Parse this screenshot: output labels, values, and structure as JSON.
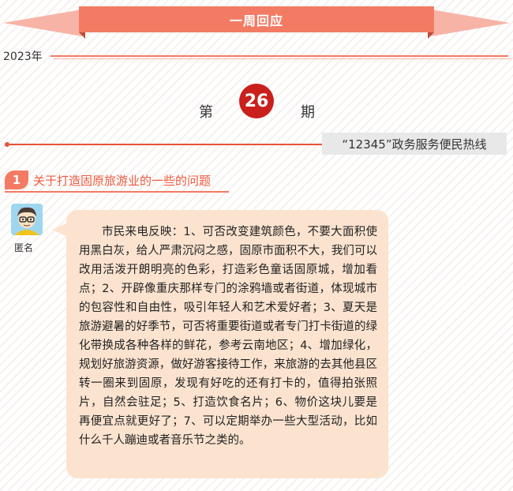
{
  "banner": {
    "title": "一周回应"
  },
  "header": {
    "year": "2023年"
  },
  "issue": {
    "prefix": "第",
    "number": "26",
    "suffix": "期"
  },
  "hotline": {
    "label": "“12345”政务服务便民热线"
  },
  "topic": {
    "number": "1",
    "title": "关于打造固原旅游业的一些的问题"
  },
  "message": {
    "sender": "匿名",
    "body": "市民来电反映：1、可否改变建筑颜色，不要大面积使用黑白灰，给人严肃沉闷之感，固原市面积不大，我们可以改用活泼开朗明亮的色彩，打造彩色童话固原城，增加看点；2、开辟像重庆那样专门的涂鸦墙或者街道，体现城市的包容性和自由性，吸引年轻人和艺术爱好者；3、夏天是旅游避暑的好季节，可否将重要街道或者专门打卡街道的绿化带换成各种各样的鲜花，参考云南地区；4、增加绿化，规划好旅游资源，做好游客接待工作，来旅游的去其他县区转一圈来到固原，发现有好吃的还有打卡的，值得拍张照片，自然会驻足；5、打造饮食名片；6、物价这块儿要是再便宜点就更好了；7、可以定期举办一些大型活动，比如什么千人蹦迪或者音乐节之类的。"
  }
}
